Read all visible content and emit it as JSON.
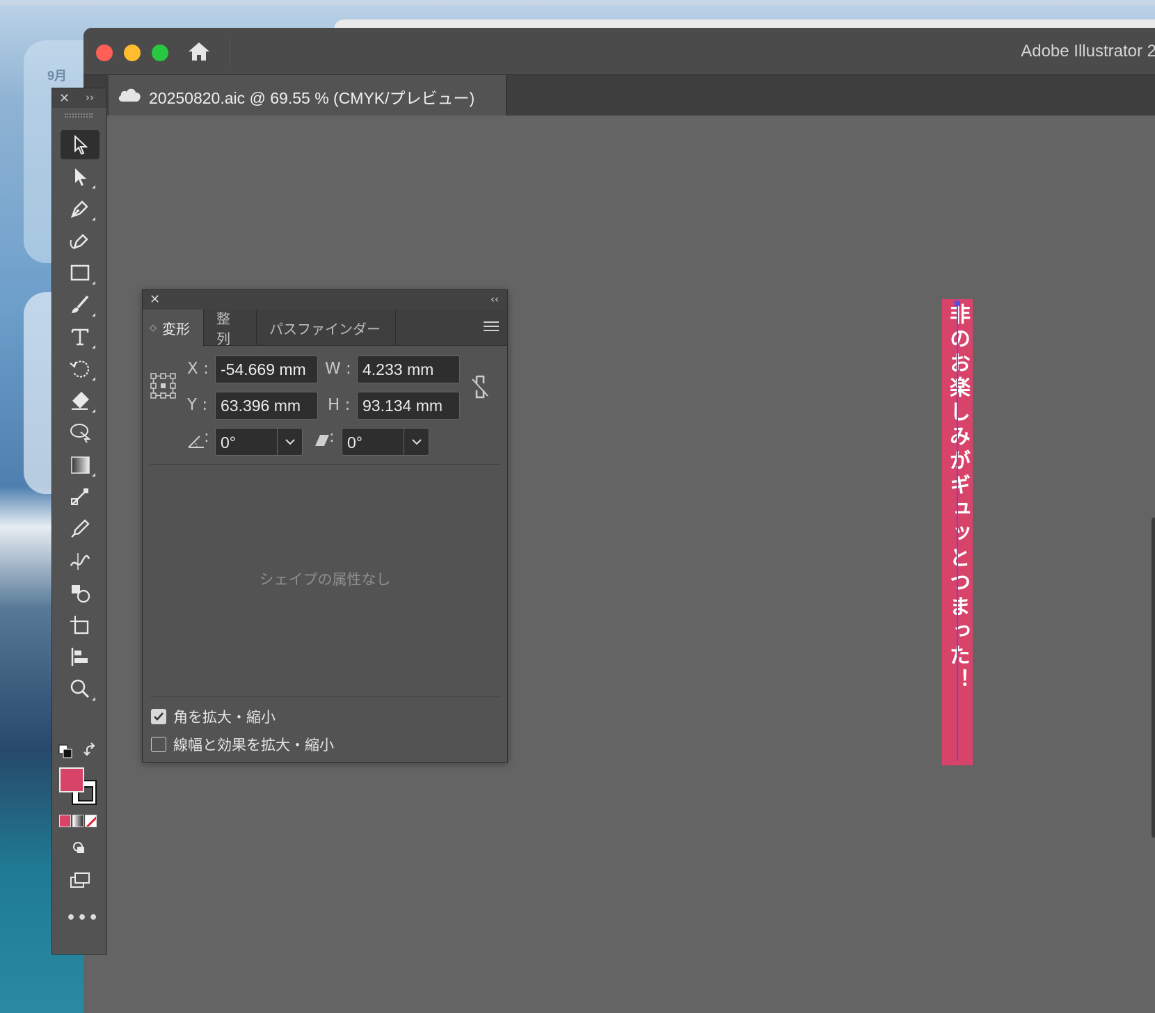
{
  "desktop": {
    "widget_month": "9月"
  },
  "window": {
    "app_title": "Adobe Illustrator 2",
    "document_tab": "20250820.aic @ 69.55 % (CMYK/プレビュー)",
    "icons": {
      "home": "home-icon",
      "cloud": "cloud-document-icon"
    }
  },
  "toolbar": {
    "tools": [
      "selection-tool",
      "direct-selection-tool",
      "pen-tool",
      "curvature-tool",
      "rectangle-tool",
      "paintbrush-tool",
      "type-tool",
      "rotate-tool",
      "eraser-tool",
      "lasso-tool",
      "gradient-tool",
      "blend-tool",
      "eyedropper-tool",
      "width-tool",
      "shape-builder-tool",
      "artboard-tool",
      "align-tool",
      "zoom-tool"
    ],
    "fill_color": "#d8436a",
    "stroke_color": "#ffffff",
    "more_label": "•••"
  },
  "panel": {
    "tabs": [
      "変形",
      "整列",
      "パスファインダー"
    ],
    "active_tab": "変形",
    "x_label": "X :",
    "x_value": "-54.669 mm",
    "y_label": "Y :",
    "y_value": "63.396 mm",
    "w_label": "W :",
    "w_value": "4.233 mm",
    "h_label": "H :",
    "h_value": "93.134 mm",
    "rotate_value": "0°",
    "shear_value": "0°",
    "no_shape_attr": "シェイプの属性なし",
    "scale_corners_label": "角を拡大・縮小",
    "scale_corners_checked": true,
    "scale_strokes_label": "線幅と効果を拡大・縮小",
    "scale_strokes_checked": false
  },
  "artwork": {
    "text": "非のお楽しみがギュッとつまった！",
    "background": "#d8436a"
  }
}
